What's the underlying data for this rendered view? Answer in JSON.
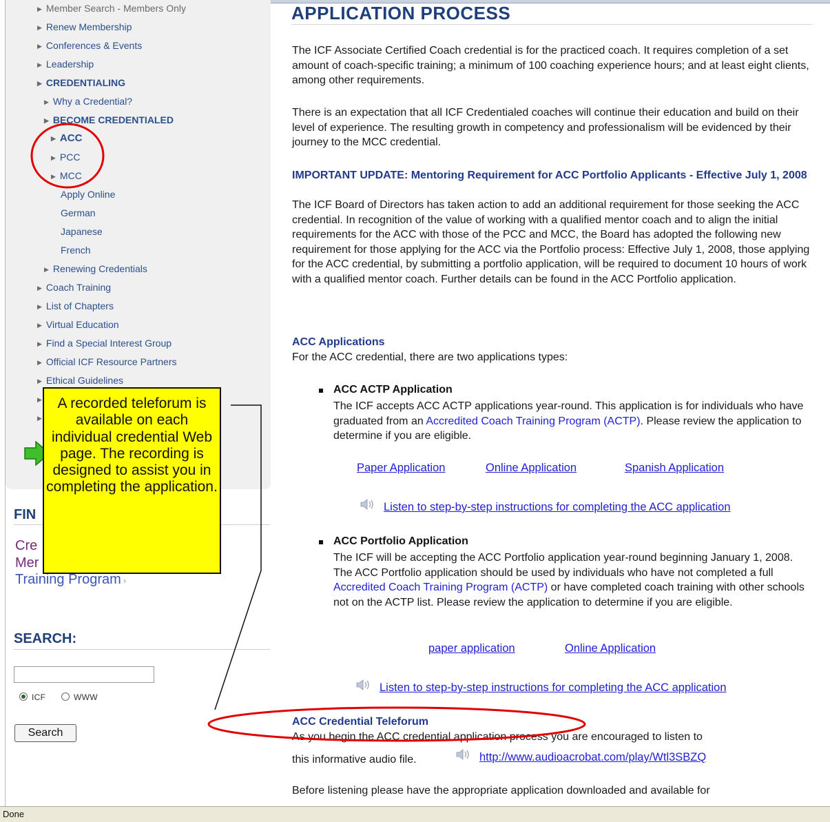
{
  "sidebar": {
    "cut_item": "Member Search - Members Only",
    "items": [
      "Renew Membership",
      "Conferences & Events",
      "Leadership",
      "CREDENTIALING",
      "Why a Credential?",
      "BECOME CREDENTIALED",
      "ACC",
      "PCC",
      "MCC",
      "Apply Online",
      "German",
      "Japanese",
      "French",
      "Renewing Credentials",
      "Coach Training",
      "List of Chapters",
      "Virtual Education",
      "Find a Special Interest Group",
      "Official ICF Resource Partners",
      "Ethical Guidelines"
    ],
    "find_heading": "FIN",
    "promo_line1": "Cre",
    "promo_line2": "Mer",
    "promo_line3": "Training Program",
    "search_heading": "SEARCH:",
    "search_value": "",
    "radio_icf": "ICF",
    "radio_www": "WWW",
    "search_button": "Search"
  },
  "main": {
    "title": "APPLICATION PROCESS",
    "intro_p1": "The ICF Associate Certified Coach credential is for the practiced coach. It requires completion of a set amount of coach-specific training; a minimum of 100 coaching experience hours; and at least eight clients, among other requirements.",
    "intro_p2": "There is an expectation that all ICF Credentialed coaches will continue their education and build on their level of experience. The resulting growth in competency and professionalism will be evidenced by their journey to the MCC credential.",
    "update_title": "IMPORTANT UPDATE: Mentoring Requirement for ACC Portfolio Applicants - Effective July 1, 2008",
    "update_body": "The ICF Board of Directors has taken action to add an additional requirement for those seeking the ACC credential.  In recognition of the value of working with a qualified mentor coach and to align the initial requirements for the ACC with those of the PCC and MCC, the Board has adopted the following new requirement for those applying for the ACC via the Portfolio process: Effective July 1, 2008, those applying for the ACC credential, by submitting a portfolio application, will be required to document 10 hours of work with a qualified mentor coach. Further details can be found in the ACC Portfolio application.",
    "apps_title": "ACC Applications",
    "apps_intro": "For the ACC credential, there are two applications types:",
    "actp": {
      "title": "ACC ACTP Application",
      "text_a": "The ICF accepts ACC ACTP applications year-round. This application is for individuals who have graduated from an ",
      "text_link": "Accredited Coach Training Program (ACTP)",
      "text_b": ". Please review the application to determine if you are eligible.",
      "link_paper": "Paper Application",
      "link_online": "Online Application",
      "link_spanish": "Spanish Application",
      "listen": "Listen to step-by-step instructions for completing the ACC application"
    },
    "portfolio": {
      "title": "ACC Portfolio Application",
      "text_a": "The ICF will be accepting the ACC Portfolio application year-round beginning January 1, 2008. The ACC Portfolio application should be used by individuals who have not completed a full ",
      "text_link": "Accredited Coach Training Program (ACTP)",
      "text_b": " or have completed coach training with other schools not on the ACTP list. Please review the application to determine if you are eligible.",
      "link_paper": "paper application",
      "link_online": "Online Application",
      "listen": "Listen to step-by-step instructions for completing the ACC application"
    },
    "teleforum_title": "ACC Credential Teleforum",
    "teleforum_p1": "As you begin the ACC credential application process you are encouraged to listen to",
    "teleforum_p2": "this informative audio file.",
    "teleforum_url": "http://www.audioacrobat.com/play/Wtl3SBZQ",
    "last_para": "Before listening please have the appropriate application downloaded and available for"
  },
  "annotation": {
    "callout": "A recorded teleforum is available on each individual credential Web page. The recording is designed to assist you in completing the application.",
    "highlight_color": "#ffff00",
    "circle_color": "#e00000"
  },
  "status": "Done"
}
